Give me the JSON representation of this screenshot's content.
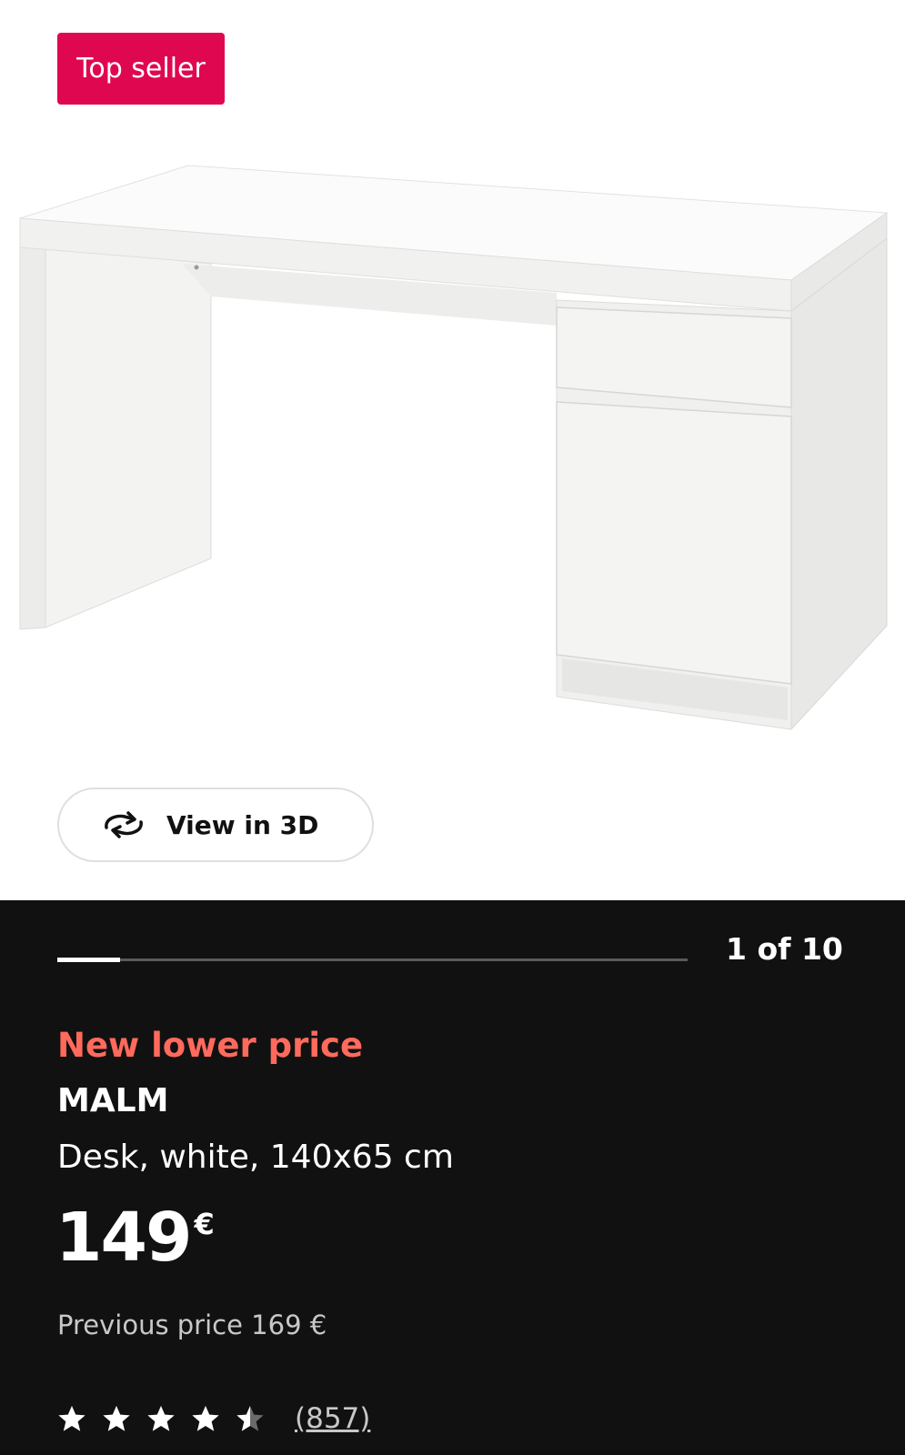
{
  "badge": {
    "label": "Top seller",
    "color": "#e00751"
  },
  "view_3d": {
    "label": "View in 3D",
    "icon": "rotate-3d-icon"
  },
  "gallery": {
    "current": 1,
    "total": 10,
    "pager_label": "1 of 10",
    "progress_fraction": 0.1
  },
  "product": {
    "promo_label": "New lower price",
    "promo_color": "#ff6a5c",
    "name": "MALM",
    "description": "Desk, white, 140x65 cm",
    "price": "149",
    "currency": "€",
    "previous_price_label": "Previous price 169 €"
  },
  "rating": {
    "stars": 4.5,
    "max_stars": 5,
    "reviews_label": "(857)",
    "icon": "star-icon"
  }
}
